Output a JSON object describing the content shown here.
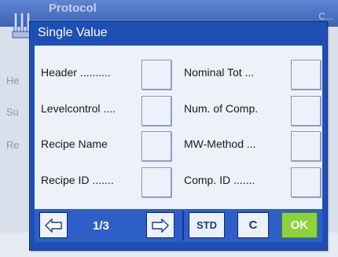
{
  "background": {
    "title": "Protocol",
    "title_right": "C...",
    "rows": [
      "He",
      "Su",
      "Re"
    ]
  },
  "dialog": {
    "title": "Single Value",
    "left_options": [
      {
        "label": "Header ..........",
        "checked": false
      },
      {
        "label": "Levelcontrol ....",
        "checked": false
      },
      {
        "label": "Recipe Name",
        "checked": false
      },
      {
        "label": "Recipe ID .......",
        "checked": false
      }
    ],
    "right_options": [
      {
        "label": "Nominal Tot ...",
        "checked": false
      },
      {
        "label": "Num. of Comp.",
        "checked": false
      },
      {
        "label": "MW-Method ...",
        "checked": false
      },
      {
        "label": "Comp. ID .......",
        "checked": false
      }
    ]
  },
  "nav": {
    "page_indicator": "1/3",
    "std_label": "STD",
    "c_label": "C",
    "ok_label": "OK"
  },
  "colors": {
    "dialog_blue": "#1e4fb5",
    "ok_green": "#8cd23c"
  }
}
